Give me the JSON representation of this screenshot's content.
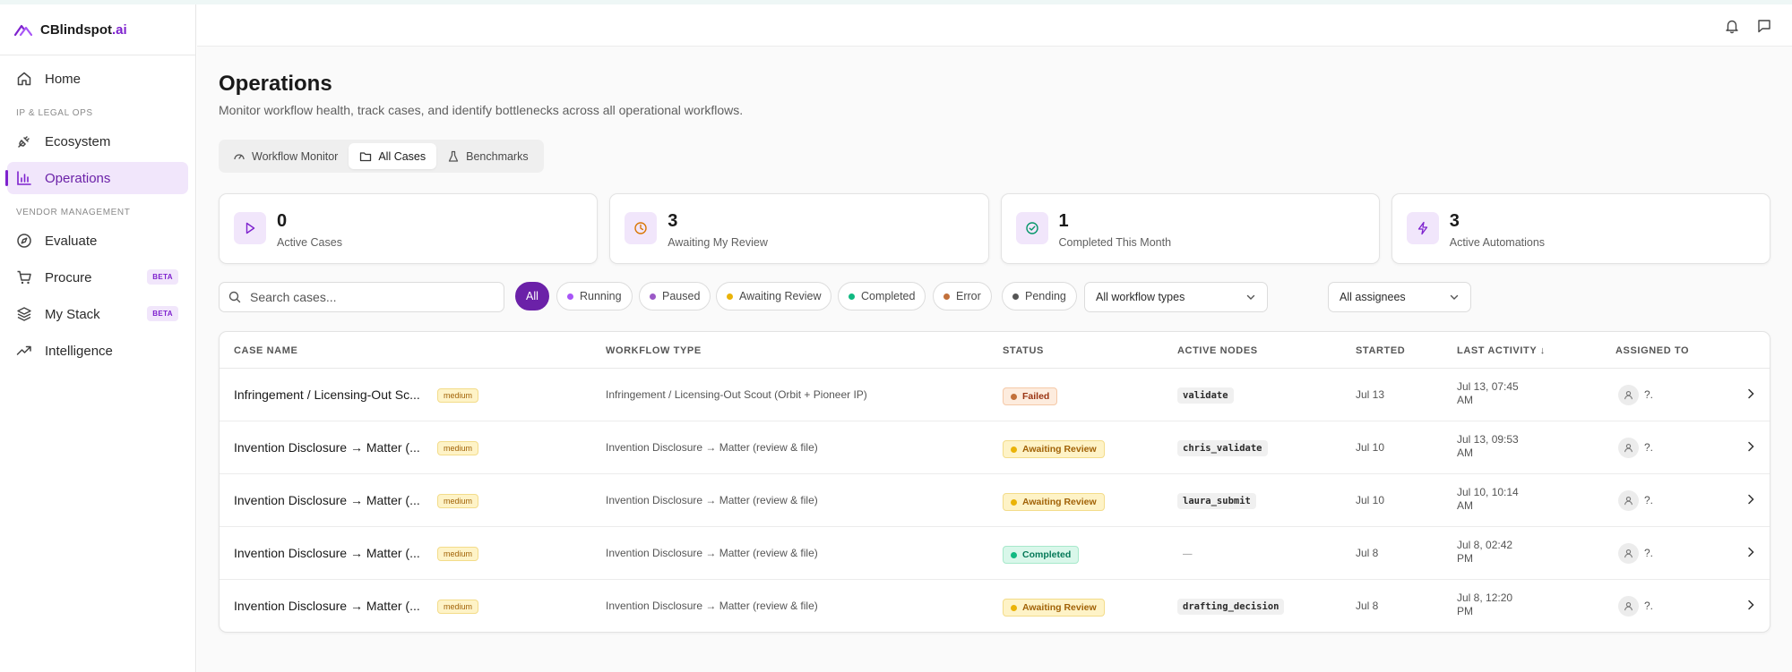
{
  "app": {
    "name_main": "CBlindspot",
    "name_accent": ".ai"
  },
  "sidebar": {
    "home": "Home",
    "section_ip": "IP & LEGAL OPS",
    "ecosystem": "Ecosystem",
    "operations": "Operations",
    "section_vendor": "VENDOR MANAGEMENT",
    "evaluate": "Evaluate",
    "procure": "Procure",
    "procure_badge": "BETA",
    "mystack": "My Stack",
    "mystack_badge": "BETA",
    "intelligence": "Intelligence"
  },
  "page": {
    "title": "Operations",
    "subtitle": "Monitor workflow health, track cases, and identify bottlenecks across all operational workflows."
  },
  "tabs": [
    "Workflow Monitor",
    "All Cases",
    "Benchmarks"
  ],
  "stats": [
    {
      "value": "0",
      "label": "Active Cases"
    },
    {
      "value": "3",
      "label": "Awaiting My Review"
    },
    {
      "value": "1",
      "label": "Completed This Month"
    },
    {
      "value": "3",
      "label": "Active Automations"
    }
  ],
  "search": {
    "placeholder": "Search cases..."
  },
  "filters": {
    "all": "All",
    "running": "Running",
    "paused": "Paused",
    "awaiting": "Awaiting Review",
    "completed": "Completed",
    "error": "Error",
    "pending": "Pending",
    "workflow_types": "All workflow types",
    "assignees": "All assignees"
  },
  "table": {
    "headers": [
      "CASE NAME",
      "WORKFLOW TYPE",
      "STATUS",
      "ACTIVE NODES",
      "STARTED",
      "LAST ACTIVITY ↓",
      "ASSIGNED TO"
    ],
    "rows": [
      {
        "name": "Infringement / Licensing-Out Sc...",
        "priority": "medium",
        "workflow": "Infringement / Licensing-Out Scout (Orbit + Pioneer IP)",
        "status": "Failed",
        "node": "validate",
        "started": "Jul 13",
        "last": "Jul 13, 07:45 AM",
        "assignee": "?."
      },
      {
        "name": "Invention Disclosure → Matter (...",
        "priority": "medium",
        "workflow": "Invention Disclosure → Matter (review & file)",
        "status": "Awaiting Review",
        "node": "chris_validate",
        "started": "Jul 10",
        "last": "Jul 13, 09:53 AM",
        "assignee": "?."
      },
      {
        "name": "Invention Disclosure → Matter (...",
        "priority": "medium",
        "workflow": "Invention Disclosure → Matter (review & file)",
        "status": "Awaiting Review",
        "node": "laura_submit",
        "started": "Jul 10",
        "last": "Jul 10, 10:14 AM",
        "assignee": "?."
      },
      {
        "name": "Invention Disclosure → Matter (...",
        "priority": "medium",
        "workflow": "Invention Disclosure → Matter (review & file)",
        "status": "Completed",
        "node": "—",
        "started": "Jul 8",
        "last": "Jul 8, 02:42 PM",
        "assignee": "?."
      },
      {
        "name": "Invention Disclosure → Matter (...",
        "priority": "medium",
        "workflow": "Invention Disclosure → Matter (review & file)",
        "status": "Awaiting Review",
        "node": "drafting_decision",
        "started": "Jul 8",
        "last": "Jul 8, 12:20 PM",
        "assignee": "?."
      }
    ]
  },
  "colors": {
    "accent": "#7e22ce",
    "failed": "#c2410c",
    "awaiting": "#eab308",
    "completed": "#10b981",
    "running": "#a855f7",
    "pending": "#555555"
  }
}
